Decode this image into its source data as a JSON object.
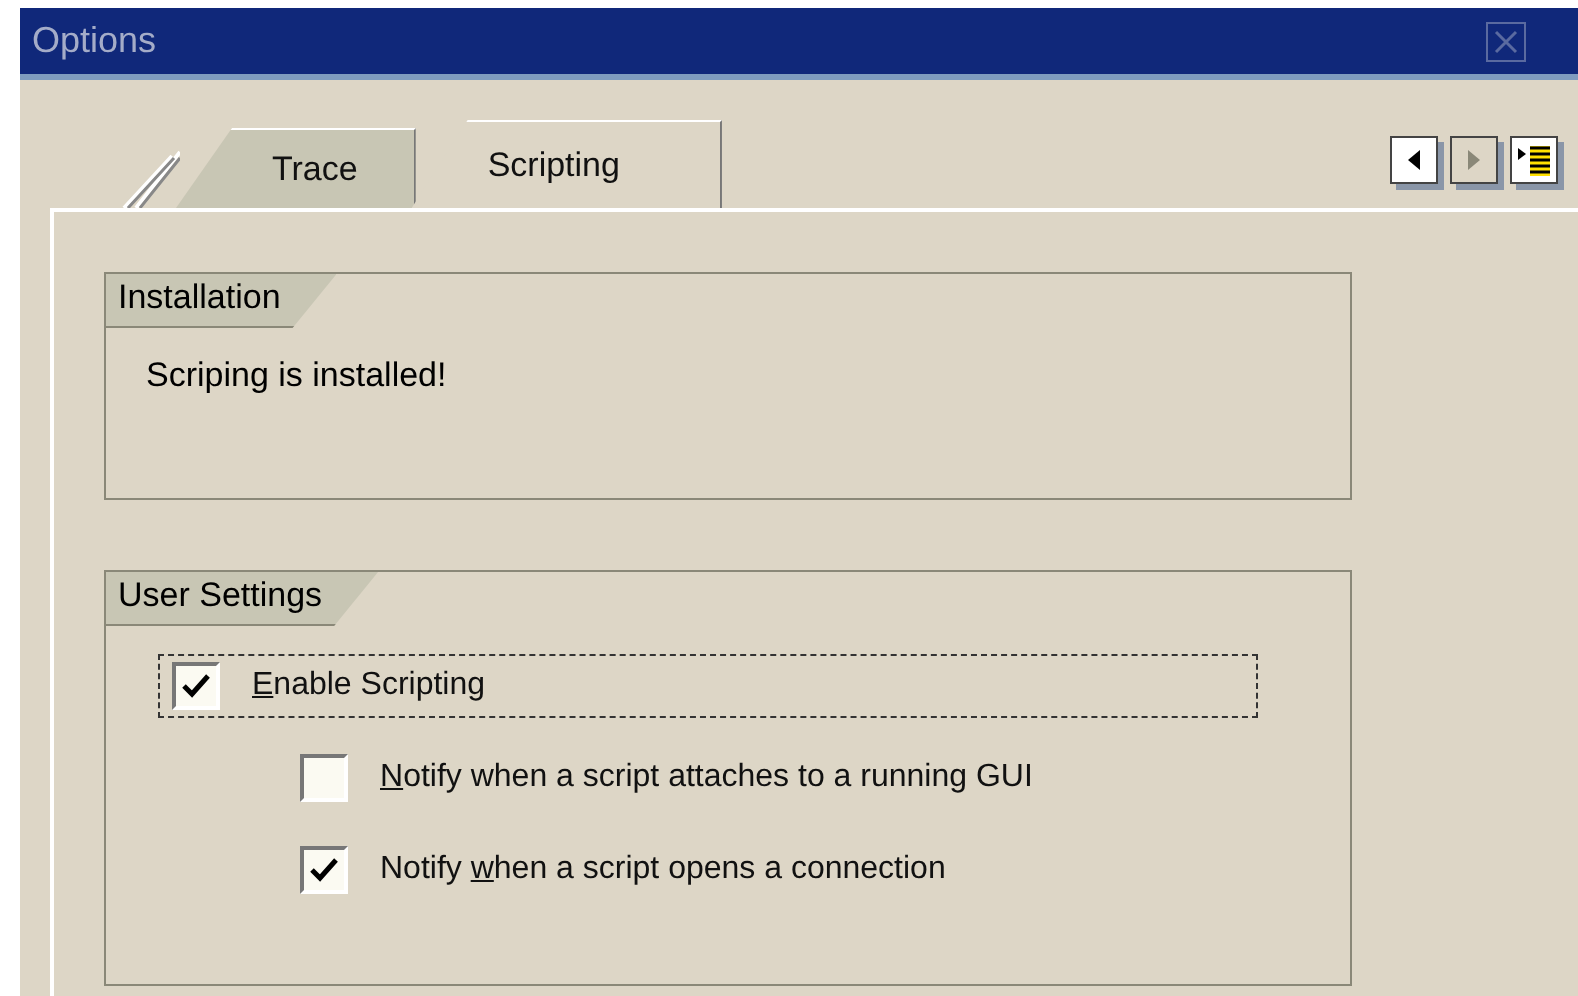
{
  "window": {
    "title": "Options"
  },
  "tabs": [
    {
      "label": "Trace",
      "selected": false
    },
    {
      "label": "Scripting",
      "selected": true
    }
  ],
  "tab_nav": [
    {
      "kind": "prev",
      "disabled": false
    },
    {
      "kind": "next",
      "disabled": true
    },
    {
      "kind": "list",
      "disabled": false
    }
  ],
  "groups": [
    {
      "title": "Installation",
      "kind": "text",
      "text": "Scriping is installed!"
    },
    {
      "title": "User Settings",
      "kind": "checks",
      "items": [
        {
          "key": "E",
          "post": "nable Scripting",
          "checked": true,
          "focused": true,
          "children": [
            {
              "key": "N",
              "post": "otify when a script attaches to a running GUI",
              "checked": false,
              "focused": false
            },
            {
              "pre": "Notify ",
              "key": "w",
              "post": "hen a script opens a connection",
              "checked": true,
              "focused": false
            }
          ]
        }
      ]
    }
  ]
}
